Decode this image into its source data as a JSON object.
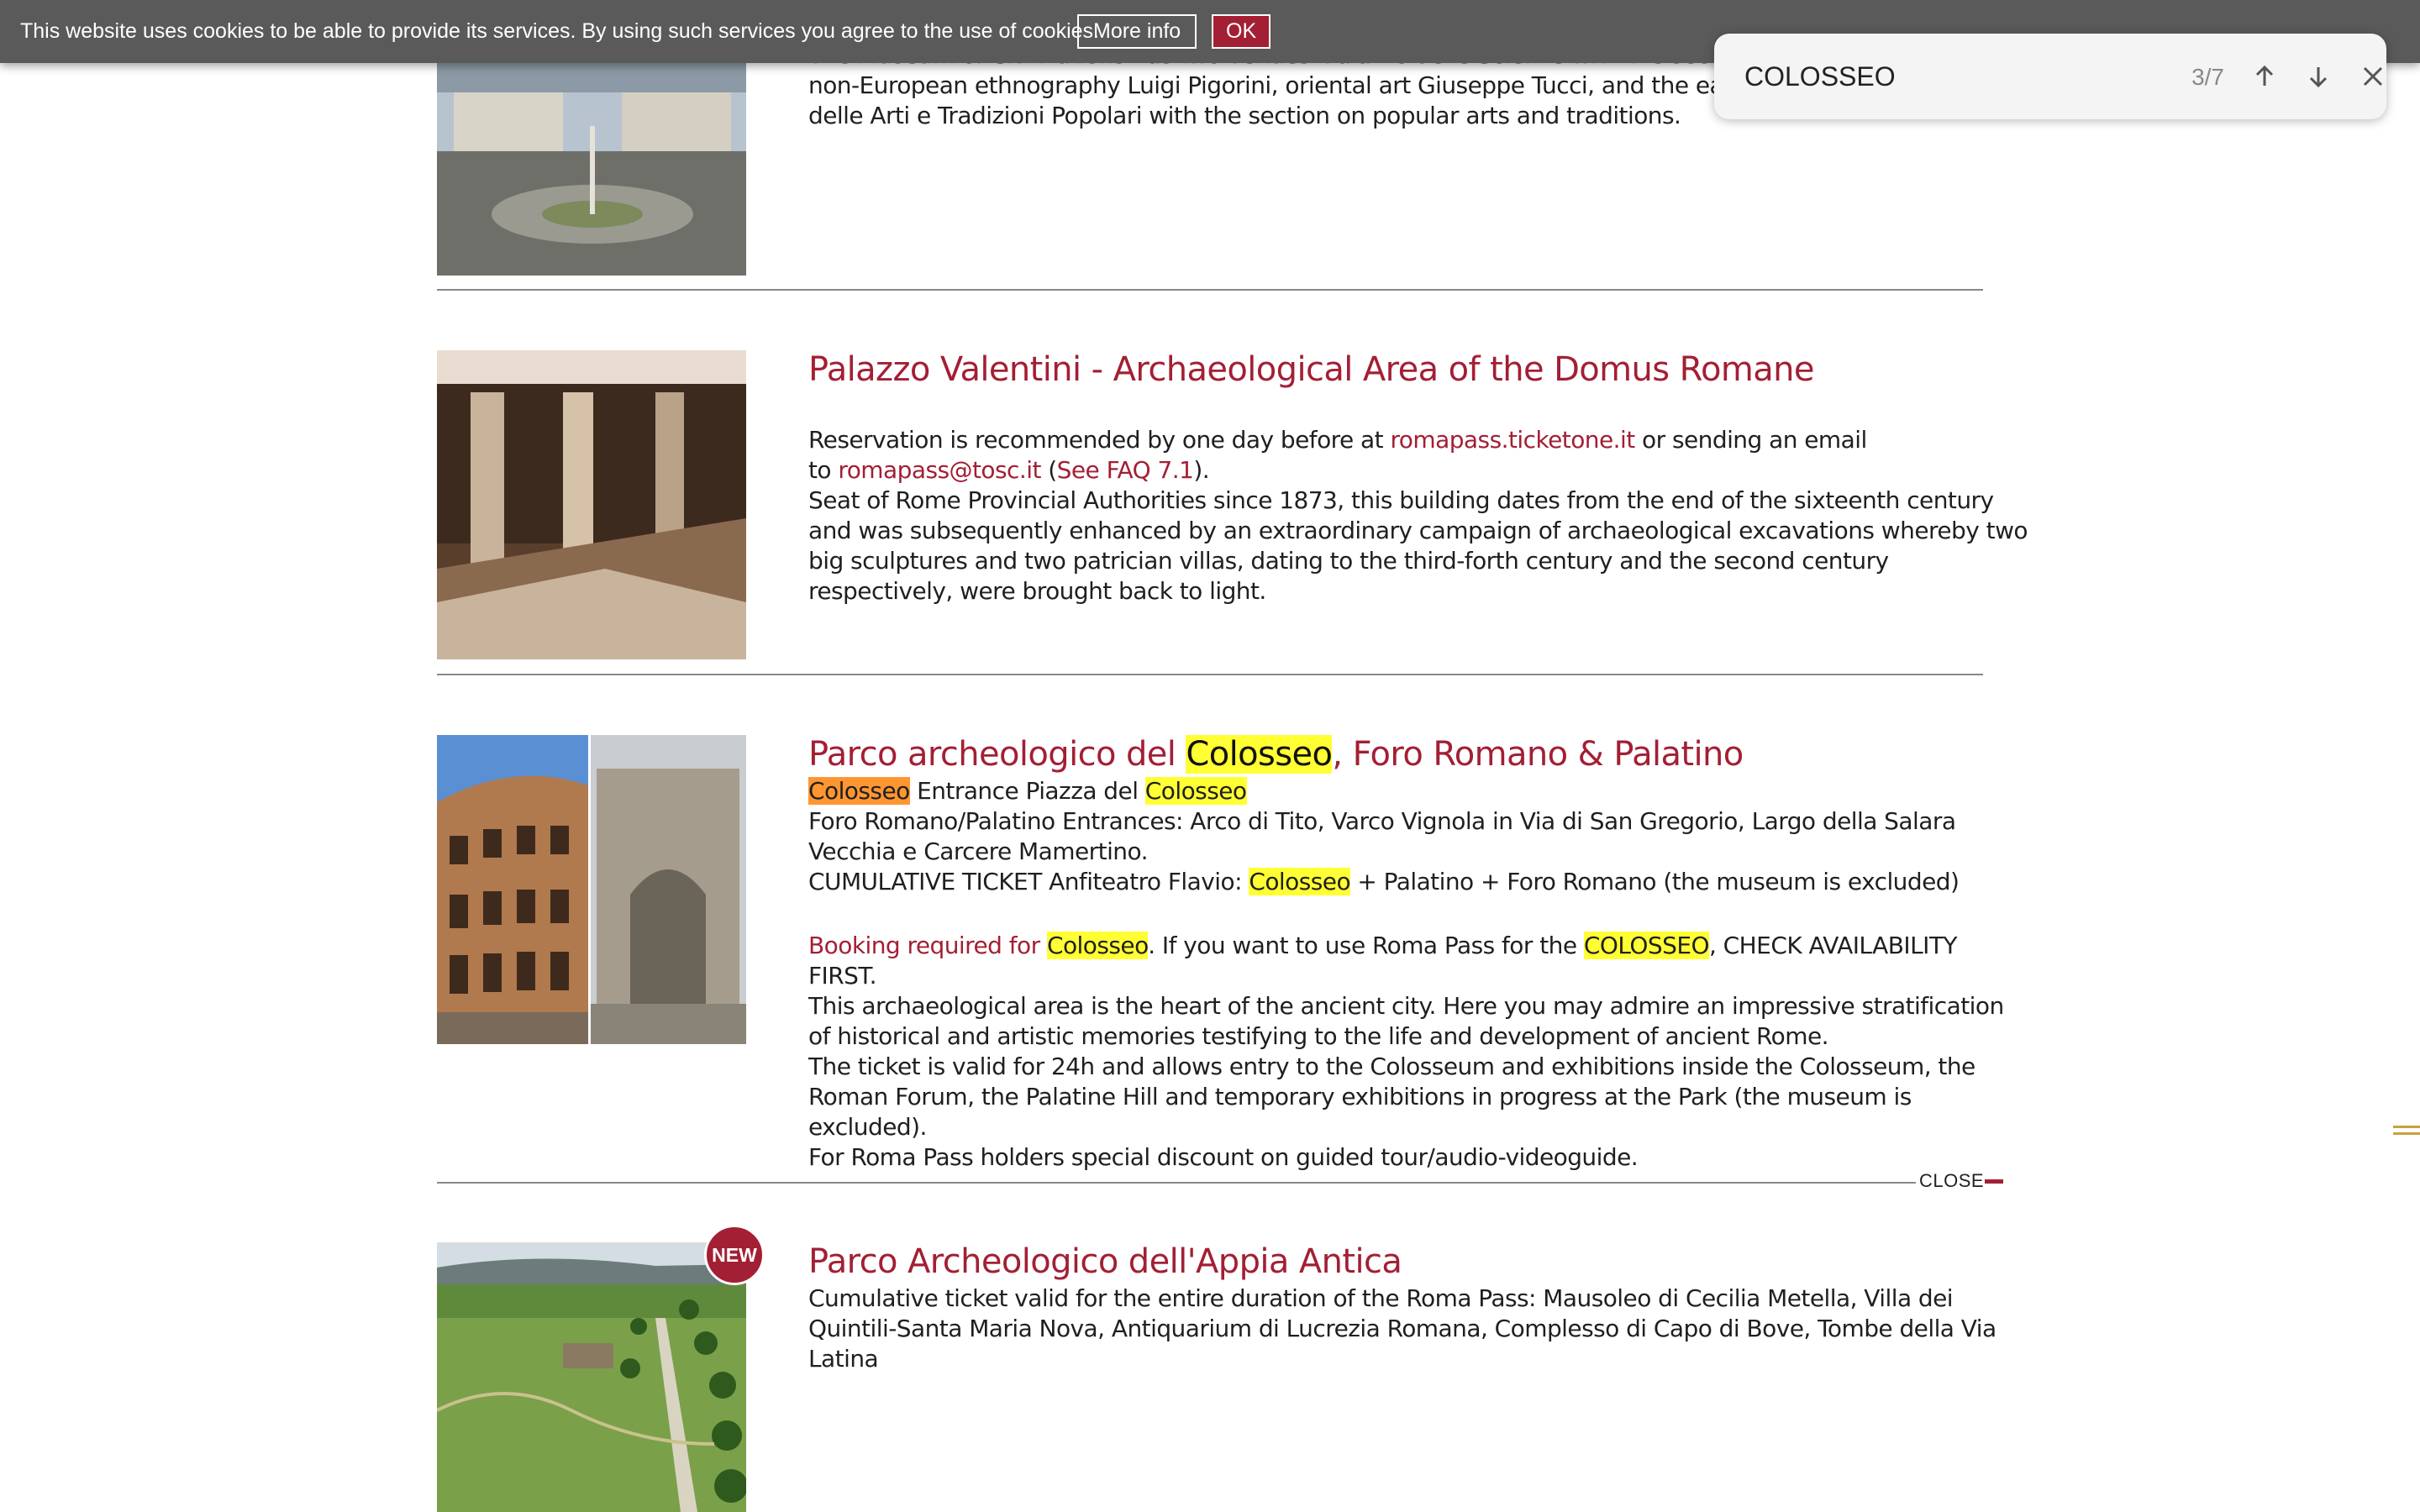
{
  "cookie_bar": {
    "message": "This website uses cookies to be able to provide its services. By using such services you agree to the use of cookies.",
    "more_info_label": "More info",
    "ok_label": "OK"
  },
  "find_bar": {
    "query": "COLOSSEO",
    "count": "3/7",
    "prev_icon": "arrow-up-icon",
    "next_icon": "arrow-down-icon",
    "close_icon": "close-icon"
  },
  "entry_museum": {
    "line1": "The Museum of Civilizations has two venues. Palazzo delle Scienze with the section",
    "line2": "non-European ethnography Luigi Pigorini, oriental art Giuseppe Tucci, and the ear",
    "line3": "delle Arti e Tradizioni Popolari with the section on popular arts and traditions."
  },
  "entry_valentini": {
    "title": "Palazzo Valentini - Archaeological Area of the Domus Romane",
    "res_prefix": "Reservation is recommended by one day before at ",
    "res_link": "romapass.ticketone.it",
    "res_mid": " or sending an email",
    "res_to": "to ",
    "email_link": "romapass@tosc.it",
    "paren_open": " (",
    "faq_link": "See FAQ 7.1",
    "paren_close": ").",
    "desc": [
      "Seat of Rome Provincial Authorities since 1873, this building dates from the end of the sixteenth century",
      "and was subsequently enhanced by an extraordinary campaign of archaeological excavations whereby two",
      "big sculptures and two patrician villas, dating to the third-forth century and the second century",
      "respectively, were brought back to light."
    ]
  },
  "entry_colosseo": {
    "title_prefix": "Parco archeologico del ",
    "title_match": "Colosseo",
    "title_suffix": ", Foro Romano & Palatino",
    "entrance_match1": "Colosseo",
    "entrance_text": " Entrance Piazza del ",
    "entrance_match2": "Colosseo",
    "foro_line1": "Foro Romano/Palatino Entrances: Arco di Tito, Varco Vignola in Via di San Gregorio, Largo della Salara",
    "foro_line2": "Vecchia e Carcere Mamertino.",
    "cumulative_prefix": "CUMULATIVE TICKET Anfiteatro Flavio: ",
    "cumulative_match": "Colosseo",
    "cumulative_suffix": " + Palatino + Foro Romano (the museum is excluded)",
    "booking_link": "Booking required for ",
    "booking_match": "Colosseo",
    "booking_mid": ". If you want to use Roma Pass for the ",
    "booking_match2": "COLOSSEO",
    "booking_suffix": ", CHECK AVAILABILITY",
    "booking_line2": "FIRST.",
    "desc": [
      "This archaeological area is the heart of the ancient city. Here you may admire an impressive stratification",
      "of historical and artistic memories testifying to the life and development of ancient Rome.",
      "The ticket is valid for 24h and allows entry to the Colosseum and exhibitions inside the Colosseum, the",
      "Roman Forum, the Palatine Hill and temporary exhibitions in progress at the Park (the museum is",
      "excluded).",
      "For Roma Pass holders special discount on guided tour/audio-videoguide."
    ],
    "close_label": "CLOSE"
  },
  "entry_appia": {
    "badge": "NEW",
    "title": "Parco Archeologico dell'Appia Antica",
    "desc": [
      "Cumulative ticket valid for the entire duration of the Roma Pass: Mausoleo di Cecilia Metella, Villa dei",
      "Quintili-Santa Maria Nova, Antiquarium di Lucrezia Romana, Complesso di Capo di Bove, Tombe della Via",
      "Latina"
    ]
  },
  "colors": {
    "accent": "#a31f34",
    "highlight": "#ffff33",
    "current_highlight": "#ff9632",
    "gold": "#c9a03f"
  }
}
